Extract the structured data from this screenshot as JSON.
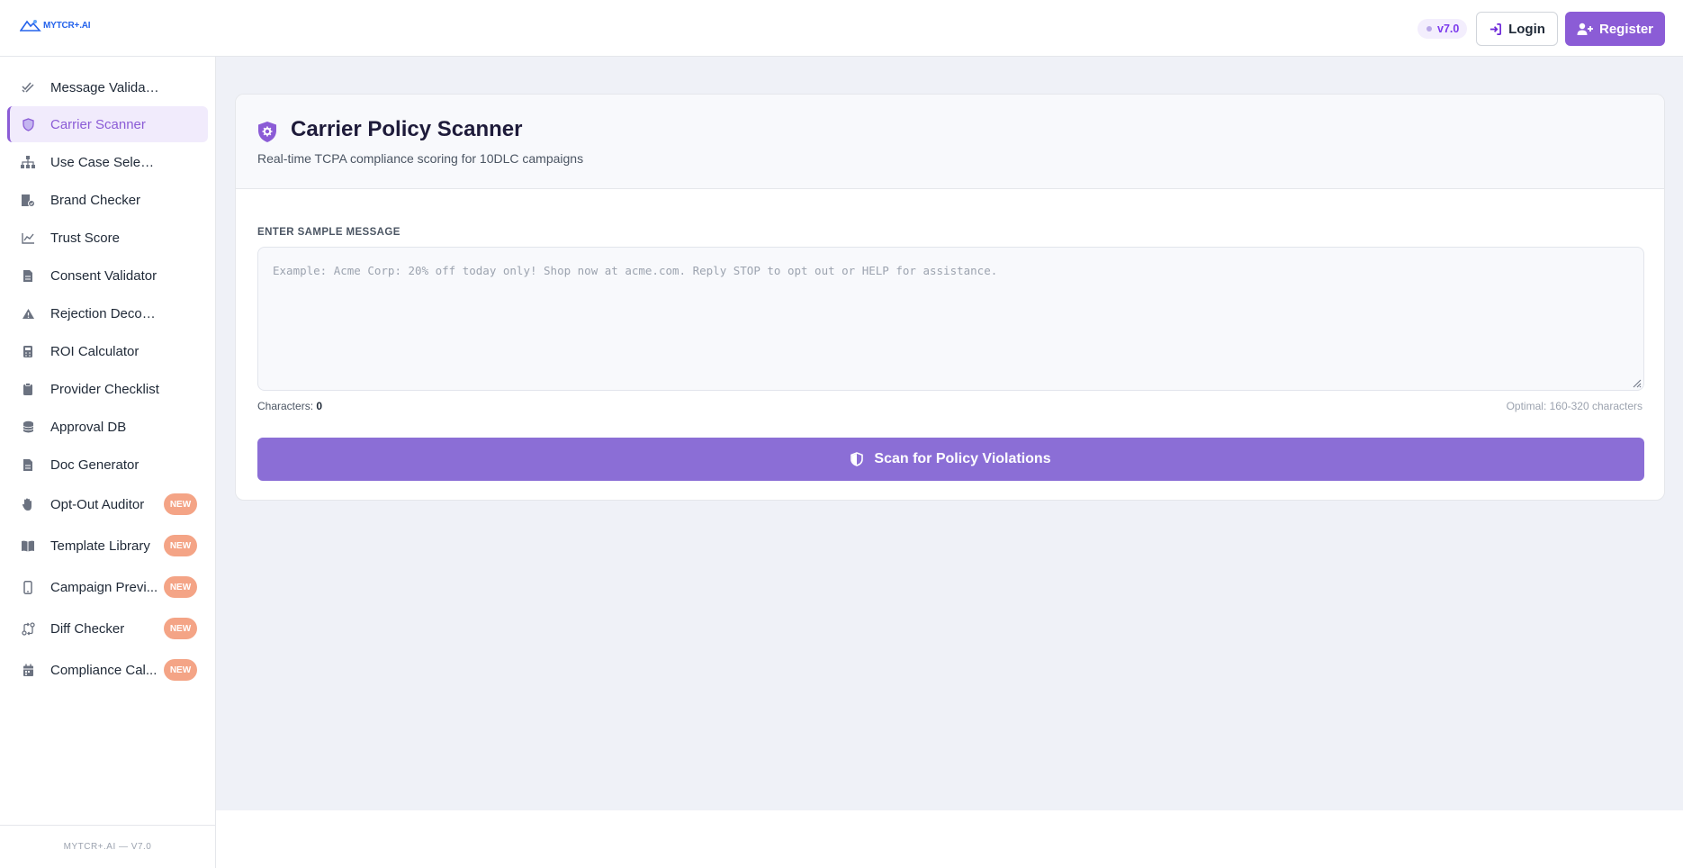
{
  "header": {
    "logo_text": "MYTCR+.AI",
    "version": "v7.0",
    "login_label": "Login",
    "register_label": "Register"
  },
  "sidebar": {
    "items": [
      {
        "label": "Message Validator",
        "icon": "check-double-icon"
      },
      {
        "label": "Carrier Scanner",
        "icon": "shield-icon",
        "active": true
      },
      {
        "label": "Use Case Selector",
        "icon": "sitemap-icon"
      },
      {
        "label": "Brand Checker",
        "icon": "building-check-icon"
      },
      {
        "label": "Trust Score",
        "icon": "chart-line-icon"
      },
      {
        "label": "Consent Validator",
        "icon": "file-icon"
      },
      {
        "label": "Rejection Decoder",
        "icon": "warning-triangle-icon"
      },
      {
        "label": "ROI Calculator",
        "icon": "calculator-icon"
      },
      {
        "label": "Provider Checklist",
        "icon": "clipboard-icon"
      },
      {
        "label": "Approval DB",
        "icon": "database-icon"
      },
      {
        "label": "Doc Generator",
        "icon": "file-icon"
      },
      {
        "label": "Opt-Out Auditor",
        "icon": "hand-icon",
        "badge": "NEW"
      },
      {
        "label": "Template Library",
        "icon": "book-icon",
        "badge": "NEW"
      },
      {
        "label": "Campaign Previ...",
        "icon": "mobile-icon",
        "badge": "NEW"
      },
      {
        "label": "Diff Checker",
        "icon": "code-compare-icon",
        "badge": "NEW"
      },
      {
        "label": "Compliance Cal...",
        "icon": "calendar-icon",
        "badge": "NEW"
      }
    ],
    "footer": "MYTCR+.AI — V7.0"
  },
  "main": {
    "title": "Carrier Policy Scanner",
    "subtitle": "Real-time TCPA compliance scoring for 10DLC campaigns",
    "field_label": "ENTER SAMPLE MESSAGE",
    "message_value": "",
    "message_placeholder": "Example: Acme Corp: 20% off today only! Shop now at acme.com. Reply STOP to opt out or HELP for assistance.",
    "char_count_label": "Characters:",
    "char_count_value": "0",
    "optimal_text": "Optimal: 160-320 characters",
    "scan_button_label": "Scan for Policy Violations"
  },
  "colors": {
    "accent": "#8b5cd6",
    "accent_light": "#f1ebfc",
    "badge_new": "#f4a486",
    "main_bg": "#eff1f7"
  }
}
